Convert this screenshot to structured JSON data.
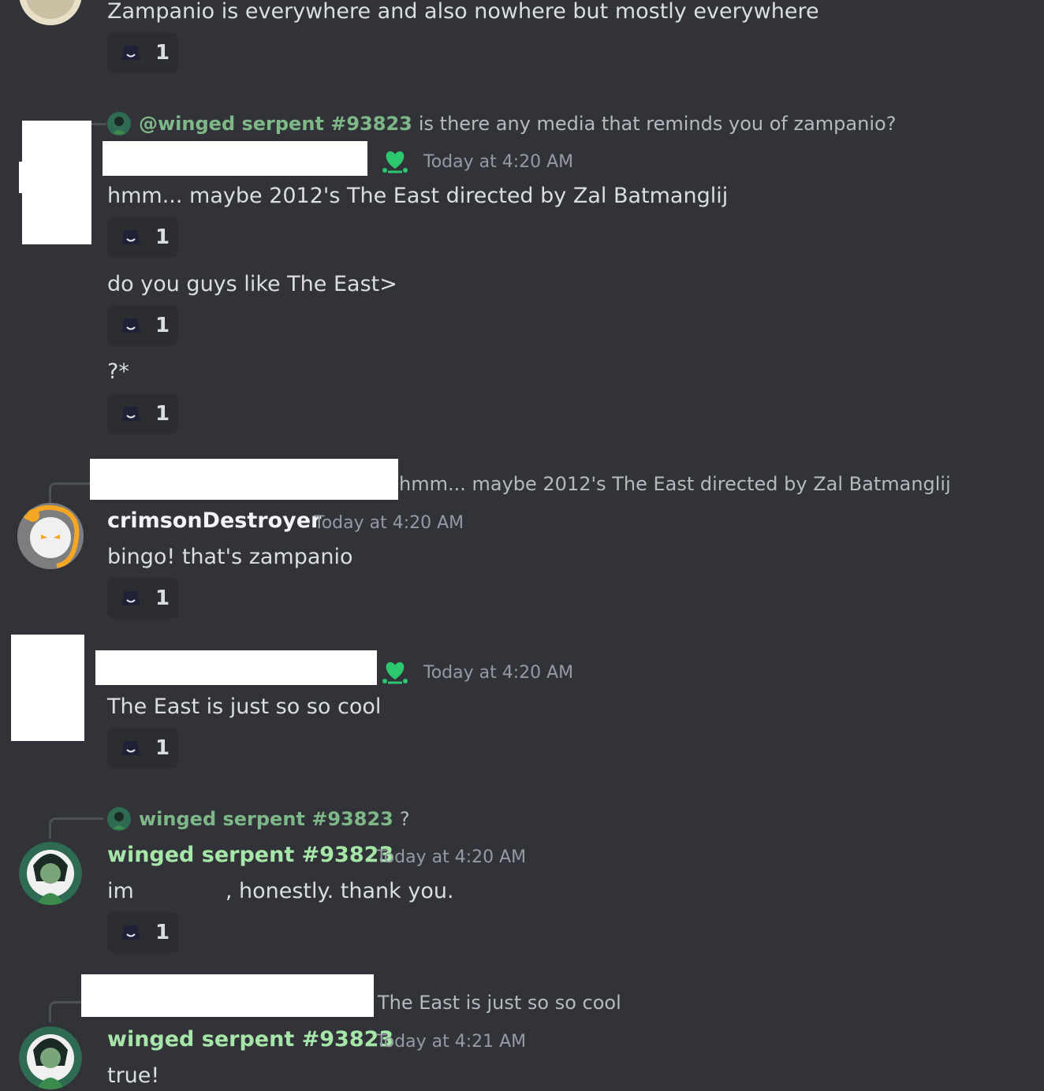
{
  "colors": {
    "background": "#313338",
    "text": "#dbdee1",
    "timestamp": "#949ba4",
    "reply_name": "#7fb888",
    "serpent_name": "#a6e6a8",
    "role_icon": "#2dc770",
    "reaction_bg": "#2b2d31"
  },
  "reaction_count": "1",
  "reaction_emoji": "dark-hat-smile-emoji",
  "messages": [
    {
      "text": "Zampanio is everywhere and also nowhere but mostly everywhere"
    },
    {
      "reply": {
        "name": "@winged serpent #93823",
        "text": "is there any media that reminds you of zampanio?"
      },
      "timestamp": "Today at 4:20 AM",
      "text": "hmm... maybe 2012's The East directed by  Zal Batmanglij"
    },
    {
      "text": "do you guys like The East>"
    },
    {
      "text": "?*"
    },
    {
      "reply": {
        "text": "hmm... maybe 2012's The East directed by Zal Batmanglij"
      },
      "author": "crimsonDestroyer",
      "timestamp": "Today at 4:20 AM",
      "text": "bingo! that's zampanio"
    },
    {
      "timestamp": "Today at 4:20 AM",
      "text": "The East is just so so cool"
    },
    {
      "reply": {
        "name": "winged serpent #93823",
        "text": "?"
      },
      "author": "winged serpent #93823",
      "timestamp": "Today at 4:20 AM",
      "text_start": "im",
      "text_end": ", honestly. thank you."
    },
    {
      "reply": {
        "text": "The East is just so so cool"
      },
      "author": "winged serpent #93823",
      "timestamp": "Today at 4:21 AM",
      "text": "true!"
    }
  ]
}
